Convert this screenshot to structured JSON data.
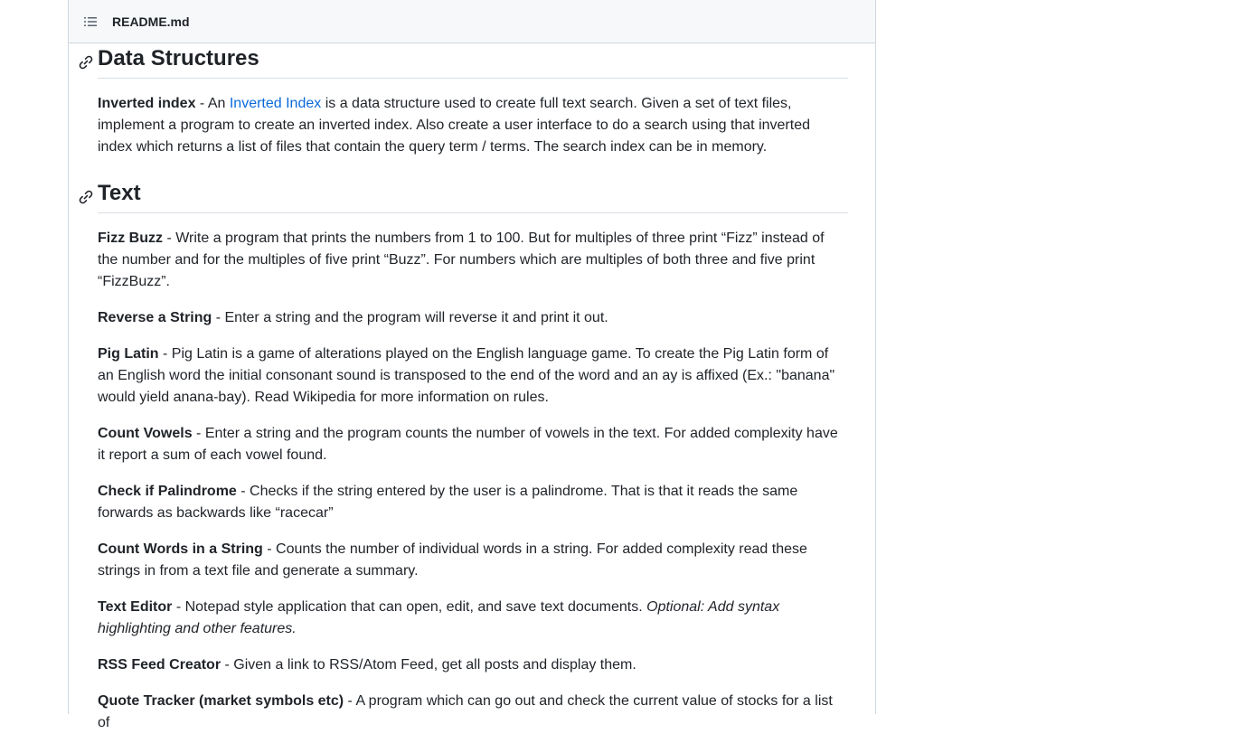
{
  "header": {
    "file_name": "README.md",
    "toc_icon": "list-unordered-icon"
  },
  "sections": [
    {
      "heading": "Data Structures",
      "anchor_icon": "link-icon",
      "items": [
        {
          "title": "Inverted index",
          "sep": " - An ",
          "link": "Inverted Index",
          "text": " is a data structure used to create full text search. Given a set of text files, implement a program to create an inverted index. Also create a user interface to do a search using that inverted index which returns a list of files that contain the query term / terms. The search index can be in memory."
        }
      ]
    },
    {
      "heading": "Text",
      "anchor_icon": "link-icon",
      "items": [
        {
          "title": "Fizz Buzz",
          "text": " - Write a program that prints the numbers from 1 to 100. But for multiples of three print “Fizz” instead of the number and for the multiples of five print “Buzz”. For numbers which are multiples of both three and five print “FizzBuzz”."
        },
        {
          "title": "Reverse a String",
          "text": " - Enter a string and the program will reverse it and print it out."
        },
        {
          "title": "Pig Latin",
          "text": " - Pig Latin is a game of alterations played on the English language game. To create the Pig Latin form of an English word the initial consonant sound is transposed to the end of the word and an ay is affixed (Ex.: \"banana\" would yield anana-bay). Read Wikipedia for more information on rules."
        },
        {
          "title": "Count Vowels",
          "text": " - Enter a string and the program counts the number of vowels in the text. For added complexity have it report a sum of each vowel found."
        },
        {
          "title": "Check if Palindrome",
          "text": " - Checks if the string entered by the user is a palindrome. That is that it reads the same forwards as backwards like “racecar”"
        },
        {
          "title": "Count Words in a String",
          "text": " - Counts the number of individual words in a string. For added complexity read these strings in from a text file and generate a summary."
        },
        {
          "title": "Text Editor",
          "text": " - Notepad style application that can open, edit, and save text documents. ",
          "em": "Optional: Add syntax highlighting and other features."
        },
        {
          "title": "RSS Feed Creator",
          "text": " - Given a link to RSS/Atom Feed, get all posts and display them."
        },
        {
          "title": "Quote Tracker (market symbols etc)",
          "text": " - A program which can go out and check the current value of stocks for a list of"
        }
      ]
    }
  ],
  "colors": {
    "link": "#0969da",
    "text": "#1f2328",
    "border": "#d0d7de",
    "header_bg": "#f6f8fa"
  }
}
